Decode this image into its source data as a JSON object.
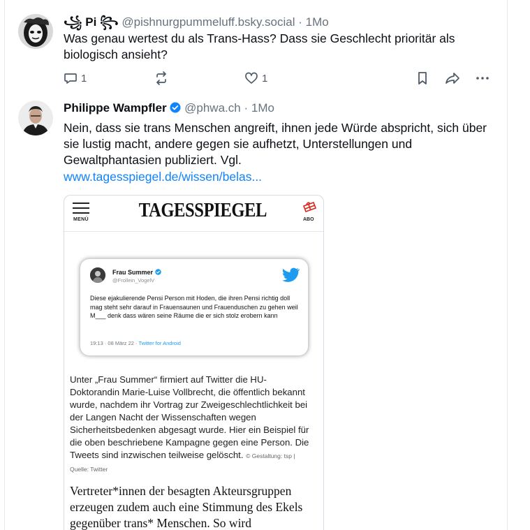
{
  "post1": {
    "display_name": "꧁ Pi ꧂",
    "handle": "@pishnurgpummeluff.bsky.social",
    "time": "1Mo",
    "text": "Was genau wertest du als Trans-Hass? Dass sie Geschlecht prioritär als biologisch ansieht?",
    "reply_count": "1",
    "repost_count": "",
    "like_count": "1"
  },
  "post2": {
    "display_name": "Philippe Wampfler",
    "handle": "@phwa.ch",
    "time": "1Mo",
    "text": "Nein, dass sie trans Menschen angreift, ihnen jede Würde abspricht, sich über sie lustig macht, andere gegen sie aufhetzt, Unterstellungen und Gewaltphantasien publiziert. Vgl.",
    "link": "www.tagesspiegel.de/wissen/belas..."
  },
  "separator": "·",
  "embed": {
    "menu_label": "MENÜ",
    "logo": "TAGESSPIEGEL",
    "abo_label": "ABO",
    "tweet": {
      "name": "Frau Summer",
      "handle": "@Frollein_VogelV",
      "text": "Diese ejakulierende Pensi Person mit Hoden, die ihren Pensi richtig doll mag steht sehr darauf in Frauensaunen und Frauenduschen zu gehen weil M___ denk dass wären seine Räume die er sich stolz erobern kann",
      "meta_time": "19:13 · 08 März 22 · ",
      "meta_client": "Twitter for Android"
    },
    "caption": "Unter „Frau Summer“ firmiert auf Twitter die HU-Doktorandin Marie-Luise Vollbrecht, die öffentlich bekannt wurde, nachdem ihr Vortrag zur Zweigeschlechtlichkeit bei der Langen Nacht der Wissenschaften wegen Sicherheitsbedenken abgesagt wurde. Hier ein Beispiel für die oben beschriebene Kampagne gegen eine Person. Die Tweets sind inzwischen teilweise gelöscht.",
    "credit": "© Gestaltung: tsp | Quelle: Twitter",
    "article_text": "Vertreter*innen der besagten Akteursgruppen erzeugen zudem auch eine Stimmung des Ekels gegenüber trans* Menschen. So wird"
  },
  "colors": {
    "link": "#1083fe",
    "muted": "#66737f",
    "verified": "#1083fe",
    "twitter_blue": "#1d9bf0"
  },
  "icons": [
    "reply-icon",
    "repost-icon",
    "like-icon",
    "bookmark-icon",
    "share-icon",
    "more-icon",
    "verified-badge-icon",
    "twitter-bird-icon",
    "gift-icon"
  ]
}
